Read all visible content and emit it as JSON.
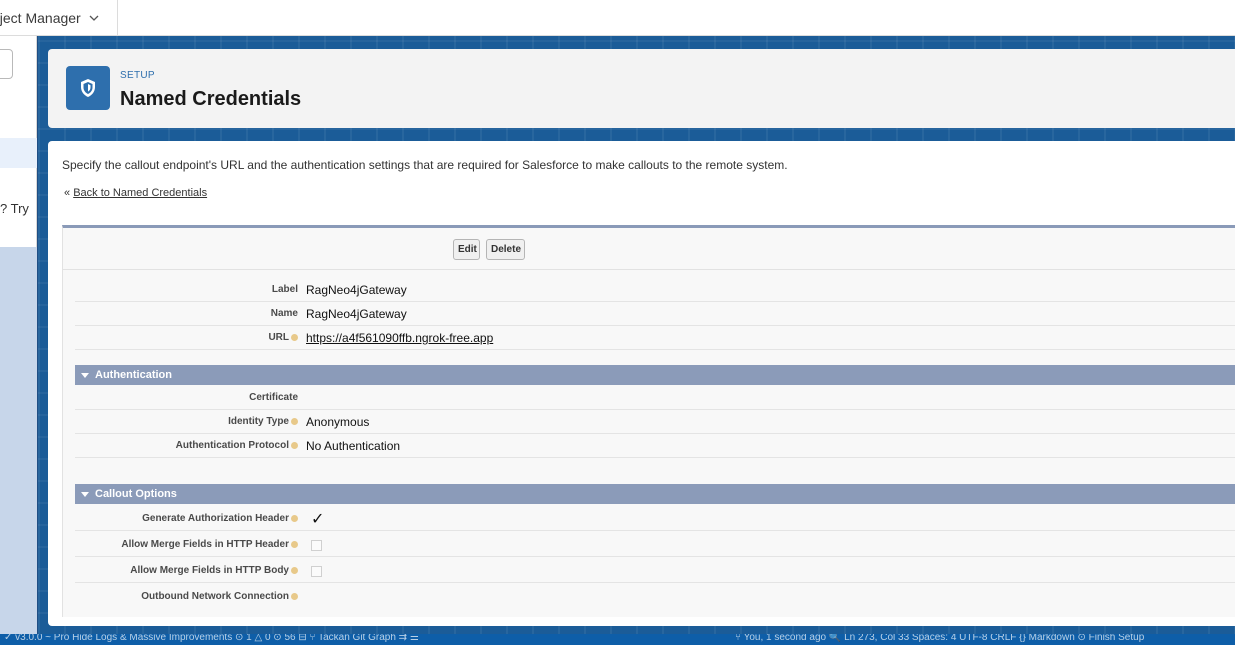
{
  "app": {
    "name": "oject Manager"
  },
  "left_panel": {
    "snippet_text": "? Try"
  },
  "header": {
    "eyebrow": "SETUP",
    "title": "Named Credentials"
  },
  "page": {
    "description": "Specify the callout endpoint's URL and the authentication settings that are required for Salesforce to make callouts to the remote system.",
    "back_prefix": "«",
    "back_link": "Back to Named Credentials"
  },
  "buttons": {
    "edit": "Edit",
    "delete": "Delete"
  },
  "fields": {
    "label": {
      "label": "Label",
      "value": "RagNeo4jGateway"
    },
    "name": {
      "label": "Name",
      "value": "RagNeo4jGateway"
    },
    "url": {
      "label": "URL",
      "value": "https://a4f561090ffb.ngrok-free.app"
    }
  },
  "authentication": {
    "title": "Authentication",
    "certificate": {
      "label": "Certificate",
      "value": ""
    },
    "identity_type": {
      "label": "Identity Type",
      "value": "Anonymous"
    },
    "auth_protocol": {
      "label": "Authentication Protocol",
      "value": "No Authentication"
    }
  },
  "callout_options": {
    "title": "Callout Options",
    "generate_auth_header": {
      "label": "Generate Authorization Header",
      "checked": true
    },
    "merge_fields_header": {
      "label": "Allow Merge Fields in HTTP Header",
      "checked": false
    },
    "merge_fields_body": {
      "label": "Allow Merge Fields in HTTP Body",
      "checked": false
    },
    "outbound_network": {
      "label": "Outbound Network Connection",
      "value": ""
    }
  },
  "statusbar": {
    "left_text": "✓ v3.0.0 ~ Pro Hide Logs & Massive Improvements   ⊙ 1 △ 0 ⊙ 56   ⊟   ⑂ Tackan   Git Graph   ⇉   ☰",
    "right_text": "⑂ You, 1 second ago   🔍   Ln 273, Col 33   Spaces: 4   UTF-8   CRLF   {} Markdown   ⊙ Finish Setup"
  },
  "icons": {
    "header": "shield-icon",
    "app_menu": "chevron-down-icon",
    "help": "help-icon",
    "section_toggle": "triangle-down-icon",
    "check": "checkmark-icon"
  },
  "colors": {
    "brand_blue": "#2e6fad",
    "section_bar": "#8b9bb9",
    "band": "#1b5c98"
  }
}
